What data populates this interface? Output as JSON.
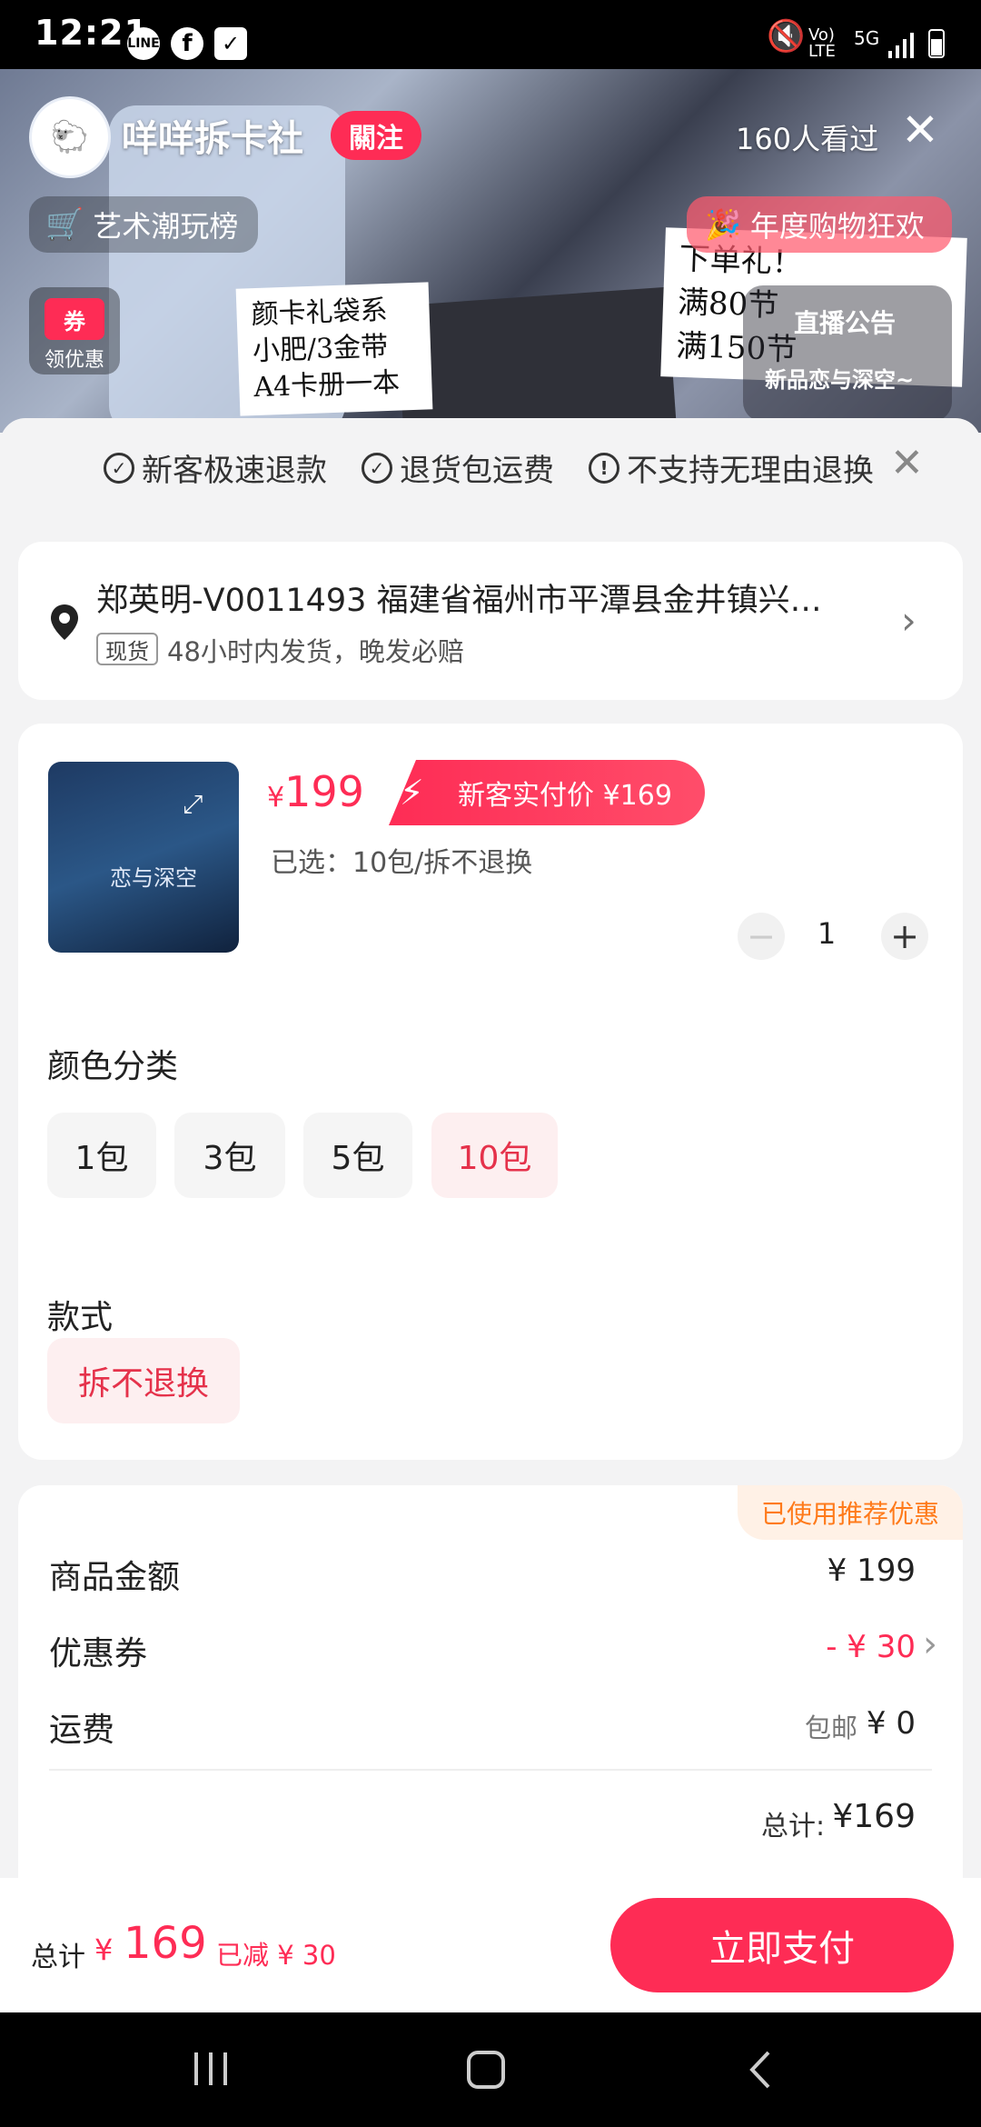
{
  "status_bar": {
    "time": "12:21",
    "app_icons": [
      "line-icon",
      "facebook-icon",
      "check-icon"
    ],
    "network": "Vo) LTE",
    "net2": "5G",
    "mute_icon": "mute-icon",
    "signal_icon": "signal-icon",
    "battery_icon": "battery-icon"
  },
  "live": {
    "shop_name": "咩咩拆卡社",
    "follow_label": "關注",
    "viewers": "160人看过",
    "rank_tag": "艺术潮玩榜",
    "event_tag": "年度购物狂欢",
    "coupon_top": "券",
    "coupon_bottom": "领优惠",
    "announcement": "直播公告",
    "announcement_text": "新品恋与深空~",
    "note_left": [
      "颜卡礼袋系",
      "小肥/3金带",
      "A4卡册一本"
    ],
    "note_right": [
      "下单礼！",
      "满80节",
      "满150节"
    ]
  },
  "guarantees": [
    "新客极速退款",
    "退货包运费",
    "不支持无理由退换"
  ],
  "address": {
    "line": "郑英明-V0011493 福建省福州市平潭县金井镇兴…",
    "stock_tag": "现货",
    "shipping": "48小时内发货，晚发必赔"
  },
  "product": {
    "price_symbol": "¥",
    "price": "199",
    "promo": "新客实付价 ¥169",
    "selected": "已选：10包/拆不退换",
    "quantity": "1",
    "thumb_text": "恋与深空"
  },
  "color_section": {
    "title": "颜色分类",
    "options": [
      "1包",
      "3包",
      "5包",
      "10包"
    ],
    "selected_index": 3
  },
  "style_section": {
    "title": "款式",
    "option": "拆不退换"
  },
  "pricing": {
    "badge": "已使用推荐优惠",
    "goods_label": "商品金额",
    "goods_value": "¥ 199",
    "coupon_label": "优惠券",
    "coupon_value": "- ¥ 30",
    "shipping_label": "运费",
    "shipping_note": "包邮",
    "shipping_value": "¥ 0",
    "total_label": "总计:",
    "total_value": "¥169"
  },
  "footer": {
    "total_label": "总计",
    "currency": "¥",
    "total": "169",
    "discount": "已减 ¥ 30",
    "pay_label": "立即支付"
  },
  "colors": {
    "accent": "#fe2c55",
    "pay_button": "#fe2c55",
    "promo_badge": "#ff8a1f"
  }
}
